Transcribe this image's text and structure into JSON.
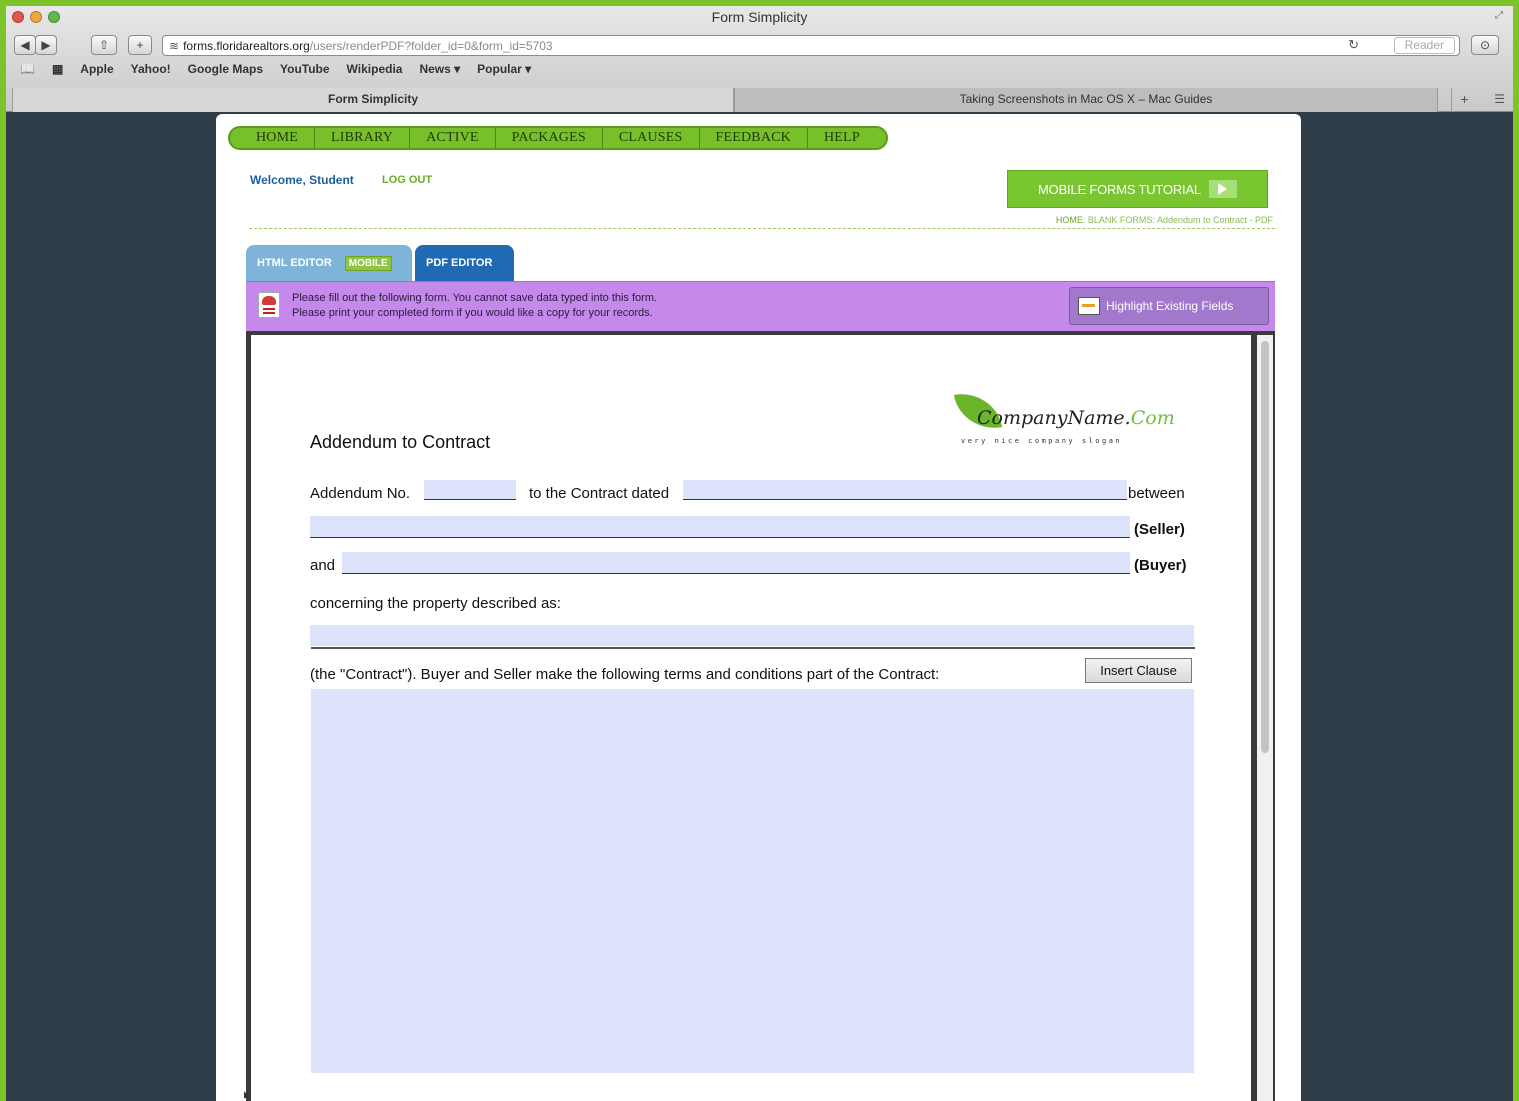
{
  "window": {
    "title": "Form Simplicity"
  },
  "toolbar": {
    "back": "◀",
    "forward": "▶",
    "share": "⇧",
    "new_tab": "+",
    "url_host": "forms.floridarealtors.org",
    "url_path": "/users/renderPDF?folder_id=0&form_id=5703",
    "reload": "↻",
    "reader": "Reader",
    "download": "⊙"
  },
  "bookmarks": [
    "Apple",
    "Yahoo!",
    "Google Maps",
    "YouTube",
    "Wikipedia",
    "News ▾",
    "Popular ▾"
  ],
  "tabs": [
    {
      "label": "Form Simplicity",
      "active": true
    },
    {
      "label": "Taking Screenshots in Mac OS X – Mac Guides",
      "active": false
    }
  ],
  "nav": [
    "HOME",
    "LIBRARY",
    "ACTIVE",
    "PACKAGES",
    "CLAUSES",
    "FEEDBACK",
    "HELP"
  ],
  "user": {
    "welcome": "Welcome, Student",
    "logout": "LOG OUT"
  },
  "tutorial_button": "MOBILE FORMS TUTORIAL",
  "breadcrumb": {
    "home": "HOME",
    "rest": ": BLANK FORMS: Addendum to Contract - PDF"
  },
  "editor_tabs": {
    "html": "HTML EDITOR",
    "mobile": "MOBILE",
    "pdf": "PDF EDITOR"
  },
  "notice": {
    "line1": "Please fill out the following form. You cannot save data typed into this form.",
    "line2": "Please print your completed form if you would like a copy for your records.",
    "highlight_button": "Highlight Existing Fields"
  },
  "form": {
    "title": "Addendum to Contract",
    "logo_name": "CompanyName.",
    "logo_com": "Com",
    "logo_slogan": "very nice company slogan",
    "addendum_label": "Addendum No.",
    "contract_dated_label": "to the Contract dated",
    "between_label": "between",
    "seller_label": "(Seller)",
    "and_label": "and",
    "buyer_label": "(Buyer)",
    "property_label": "concerning the property described as:",
    "terms_label": "(the \"Contract\").  Buyer and Seller make the following terms and conditions part of the Contract:",
    "insert_clause": "Insert Clause"
  },
  "colors": {
    "accent_green": "#7cc42a",
    "field_fill": "#dde3fb",
    "notice_purple": "#c489ea",
    "pdf_tab_blue": "#1f6ab3"
  }
}
